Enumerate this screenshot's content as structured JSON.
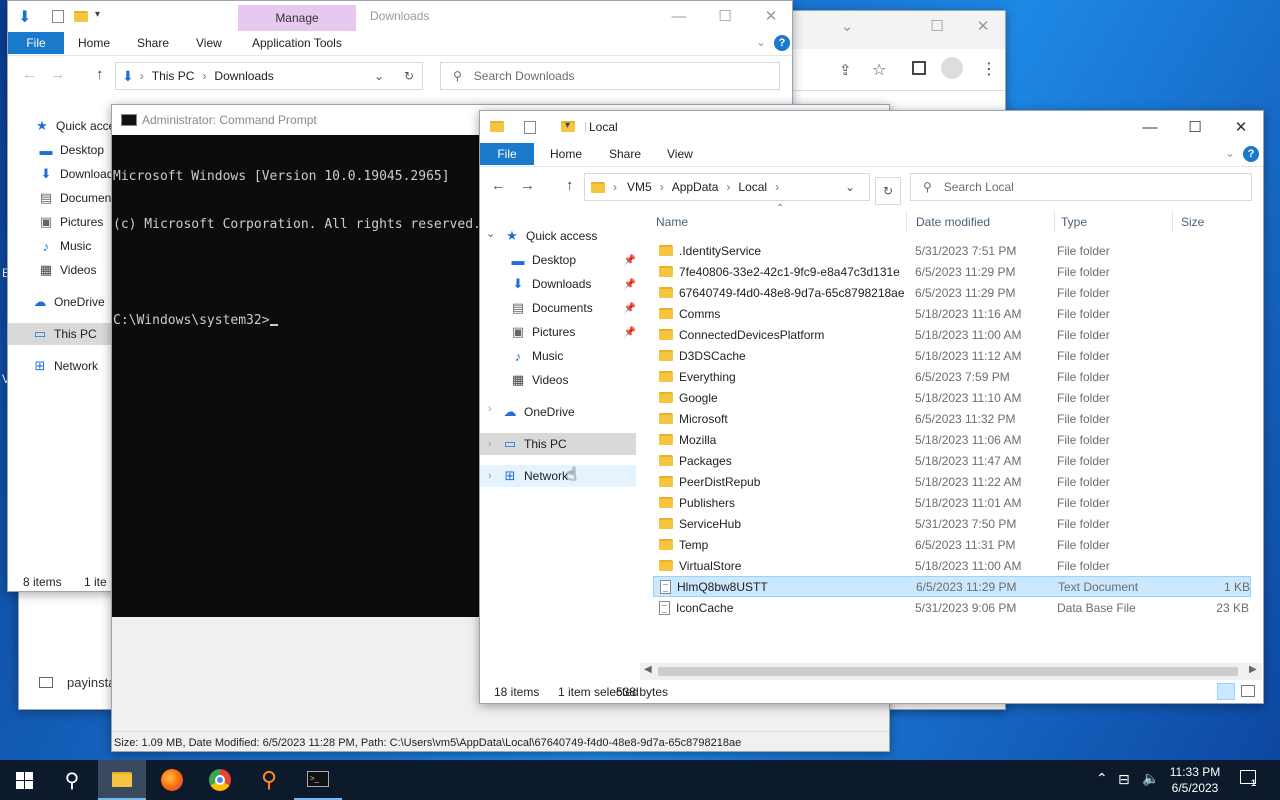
{
  "desktop": {
    "edge_labels": [
      "E",
      "V"
    ]
  },
  "chrome_window": {
    "title_buttons": [
      "chevron-down",
      "maximize",
      "close"
    ],
    "bottom_item": "payinsta"
  },
  "downloads_window": {
    "title": "Downloads",
    "manage_label": "Manage",
    "tabs": {
      "file": "File",
      "home": "Home",
      "share": "Share",
      "view": "View",
      "app_tools": "Application Tools"
    },
    "address": {
      "root": "This PC",
      "folder": "Downloads"
    },
    "search_placeholder": "Search Downloads",
    "nav": {
      "quick_access": "Quick acce",
      "desktop": "Desktop",
      "downloads": "Download",
      "documents": "Documen",
      "pictures": "Pictures",
      "music": "Music",
      "videos": "Videos",
      "onedrive": "OneDrive",
      "this_pc": "This PC",
      "network": "Network"
    },
    "status": {
      "items": "8 items",
      "selected": "1 ite"
    }
  },
  "cmd_window": {
    "title": "Administrator: Command Prompt",
    "lines": [
      "Microsoft Windows [Version 10.0.19045.2965]",
      "(c) Microsoft Corporation. All rights reserved.",
      "",
      "C:\\Windows\\system32>"
    ],
    "bottom_status": "Size: 1.09 MB, Date Modified: 6/5/2023 11:28 PM, Path: C:\\Users\\vm5\\AppData\\Local\\67640749-f4d0-48e8-9d7a-65c8798218ae"
  },
  "local_window": {
    "title": "Local",
    "tabs": {
      "file": "File",
      "home": "Home",
      "share": "Share",
      "view": "View"
    },
    "breadcrumb": [
      "VM5",
      "AppData",
      "Local"
    ],
    "search_placeholder": "Search Local",
    "nav": {
      "quick_access": "Quick access",
      "desktop": "Desktop",
      "downloads": "Downloads",
      "documents": "Documents",
      "pictures": "Pictures",
      "music": "Music",
      "videos": "Videos",
      "onedrive": "OneDrive",
      "this_pc": "This PC",
      "network": "Network"
    },
    "columns": {
      "name": "Name",
      "date": "Date modified",
      "type": "Type",
      "size": "Size"
    },
    "files": [
      {
        "name": ".IdentityService",
        "date": "5/31/2023 7:51 PM",
        "type": "File folder",
        "size": "",
        "kind": "folder"
      },
      {
        "name": "7fe40806-33e2-42c1-9fc9-e8a47c3d131e",
        "date": "6/5/2023 11:29 PM",
        "type": "File folder",
        "size": "",
        "kind": "folder"
      },
      {
        "name": "67640749-f4d0-48e8-9d7a-65c8798218ae",
        "date": "6/5/2023 11:29 PM",
        "type": "File folder",
        "size": "",
        "kind": "folder"
      },
      {
        "name": "Comms",
        "date": "5/18/2023 11:16 AM",
        "type": "File folder",
        "size": "",
        "kind": "folder"
      },
      {
        "name": "ConnectedDevicesPlatform",
        "date": "5/18/2023 11:00 AM",
        "type": "File folder",
        "size": "",
        "kind": "folder"
      },
      {
        "name": "D3DSCache",
        "date": "5/18/2023 11:12 AM",
        "type": "File folder",
        "size": "",
        "kind": "folder"
      },
      {
        "name": "Everything",
        "date": "6/5/2023 7:59 PM",
        "type": "File folder",
        "size": "",
        "kind": "folder"
      },
      {
        "name": "Google",
        "date": "5/18/2023 11:10 AM",
        "type": "File folder",
        "size": "",
        "kind": "folder"
      },
      {
        "name": "Microsoft",
        "date": "6/5/2023 11:32 PM",
        "type": "File folder",
        "size": "",
        "kind": "folder"
      },
      {
        "name": "Mozilla",
        "date": "5/18/2023 11:06 AM",
        "type": "File folder",
        "size": "",
        "kind": "folder"
      },
      {
        "name": "Packages",
        "date": "5/18/2023 11:47 AM",
        "type": "File folder",
        "size": "",
        "kind": "folder"
      },
      {
        "name": "PeerDistRepub",
        "date": "5/18/2023 11:22 AM",
        "type": "File folder",
        "size": "",
        "kind": "folder"
      },
      {
        "name": "Publishers",
        "date": "5/18/2023 11:01 AM",
        "type": "File folder",
        "size": "",
        "kind": "folder"
      },
      {
        "name": "ServiceHub",
        "date": "5/31/2023 7:50 PM",
        "type": "File folder",
        "size": "",
        "kind": "folder"
      },
      {
        "name": "Temp",
        "date": "6/5/2023 11:31 PM",
        "type": "File folder",
        "size": "",
        "kind": "folder"
      },
      {
        "name": "VirtualStore",
        "date": "5/18/2023 11:00 AM",
        "type": "File folder",
        "size": "",
        "kind": "folder"
      },
      {
        "name": "HlmQ8bw8USTT",
        "date": "6/5/2023 11:29 PM",
        "type": "Text Document",
        "size": "1 KB",
        "kind": "text",
        "selected": true
      },
      {
        "name": "IconCache",
        "date": "5/31/2023 9:06 PM",
        "type": "Data Base File",
        "size": "23 KB",
        "kind": "db"
      }
    ],
    "status": {
      "items": "18 items",
      "selected": "1 item selected",
      "bytes": "538 bytes"
    }
  },
  "taskbar": {
    "time": "11:33 PM",
    "date": "6/5/2023",
    "notification_count": "1",
    "apps": [
      "start",
      "search",
      "file-explorer",
      "firefox",
      "chrome",
      "search-everything",
      "command-prompt"
    ]
  },
  "colors": {
    "accent": "#1979ca",
    "selection": "#cce8ff",
    "taskbar": "#0d1a2b"
  }
}
